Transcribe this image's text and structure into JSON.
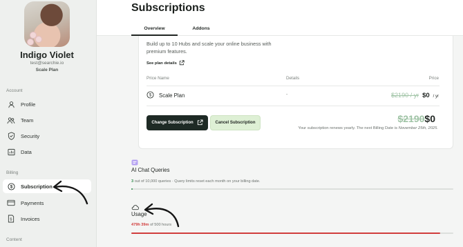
{
  "user": {
    "name": "Indigo Violet",
    "email": "test@searchie.io",
    "plan": "Scale Plan"
  },
  "sidebar": {
    "account_label": "Account",
    "account_items": [
      {
        "label": "Profile",
        "icon": "user-icon"
      },
      {
        "label": "Team",
        "icon": "team-icon"
      },
      {
        "label": "Security",
        "icon": "shield-icon"
      },
      {
        "label": "Data",
        "icon": "data-icon"
      }
    ],
    "billing_label": "Billing",
    "billing_items": [
      {
        "label": "Subscription",
        "icon": "dollar-circle-icon",
        "active": true
      },
      {
        "label": "Payments",
        "icon": "card-icon"
      },
      {
        "label": "Invoices",
        "icon": "invoice-icon"
      }
    ],
    "content_label": "Content"
  },
  "header": {
    "title": "Subscriptions",
    "tabs": [
      {
        "label": "Overview",
        "active": true
      },
      {
        "label": "Addons",
        "active": false
      }
    ]
  },
  "plan_card": {
    "blurb": "Build up to 10 Hubs and scale your online business with premium features.",
    "details_link": "See plan details",
    "columns": {
      "name": "Price Name",
      "details": "Details",
      "price": "Price"
    },
    "row": {
      "name": "Scale Plan",
      "details": "-",
      "old_price": "$2190 / yr",
      "new_price": "$0",
      "period": "/ yr"
    },
    "change_button": "Change Subscription",
    "cancel_button": "Cancel Subscription",
    "total_old": "$2190",
    "total_new": "$0",
    "renew_text": "Your subscription renews yearly. The next Billing Date is",
    "renew_date": "November 25th, 2025."
  },
  "ai_queries": {
    "title": "AI Chat Queries",
    "used": "3",
    "limit_text": "out of 10,000 queries",
    "note": "· Query limits reset each month on your billing date.",
    "fraction": 0.0003
  },
  "usage": {
    "title": "Usage",
    "used": "479h 39m",
    "limit_text": "of 500 hours",
    "fraction": 0.959
  },
  "colors": {
    "accent_dark": "#1e2a25",
    "accent_light_green": "#def0d5",
    "strike_green": "#9fc3a5",
    "usage_red": "#d13b3b",
    "query_green": "#2f8a4a"
  }
}
